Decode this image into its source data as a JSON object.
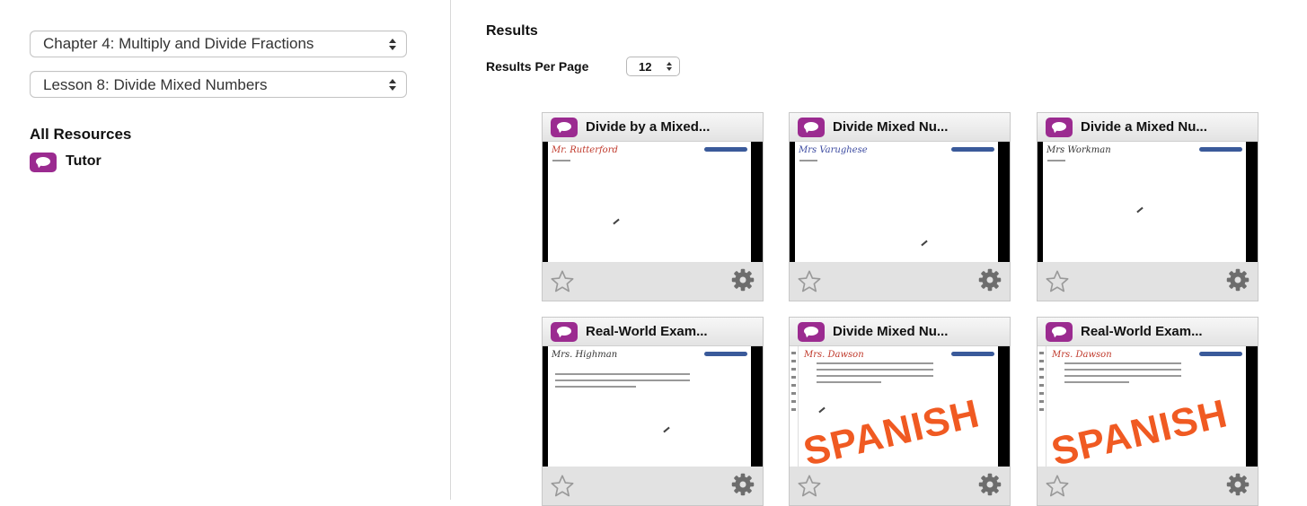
{
  "sidebar": {
    "chapter_select": "Chapter 4: Multiply and Divide Fractions",
    "lesson_select": "Lesson 8: Divide Mixed Numbers",
    "all_resources_label": "All Resources",
    "tutor_label": "Tutor"
  },
  "results": {
    "title": "Results",
    "per_page_label": "Results Per Page",
    "per_page_value": "12",
    "cards": [
      {
        "title": "Divide by a Mixed...",
        "teacher": "Mr. Rutterford"
      },
      {
        "title": "Divide Mixed Nu...",
        "teacher": "Mrs Varughese"
      },
      {
        "title": "Divide a Mixed Nu...",
        "teacher": "Mrs Workman"
      },
      {
        "title": "Real-World Exam...",
        "teacher": "Mrs. Highman"
      },
      {
        "title": "Divide Mixed Nu...",
        "teacher": "Mrs. Dawson",
        "overlay": "SPANISH"
      },
      {
        "title": "Real-World Exam...",
        "teacher": "Mrs. Dawson",
        "overlay": "SPANISH"
      }
    ]
  },
  "colors": {
    "tutor_icon": "#9b2b90",
    "spanish_text": "#f05a22",
    "card_footer": "#e2e2e2"
  },
  "icons": {
    "tutor": "chat-bubble-icon",
    "favorite": "star-outline-icon",
    "settings": "gear-icon"
  }
}
